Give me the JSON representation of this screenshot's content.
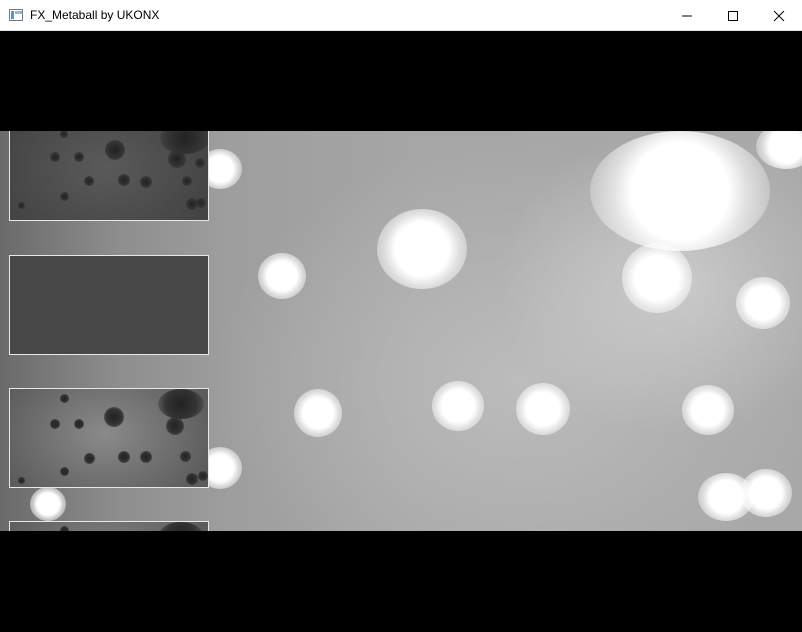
{
  "window": {
    "title": "FX_Metaball by UKONX",
    "icons": {
      "app": "app-window-icon",
      "minimize": "minimize-icon",
      "maximize": "maximize-icon",
      "close": "close-icon"
    }
  },
  "colors": {
    "titlebar_bg": "#ffffff",
    "letterbox": "#000000",
    "thumbnail_border": "#e8e8e8"
  }
}
